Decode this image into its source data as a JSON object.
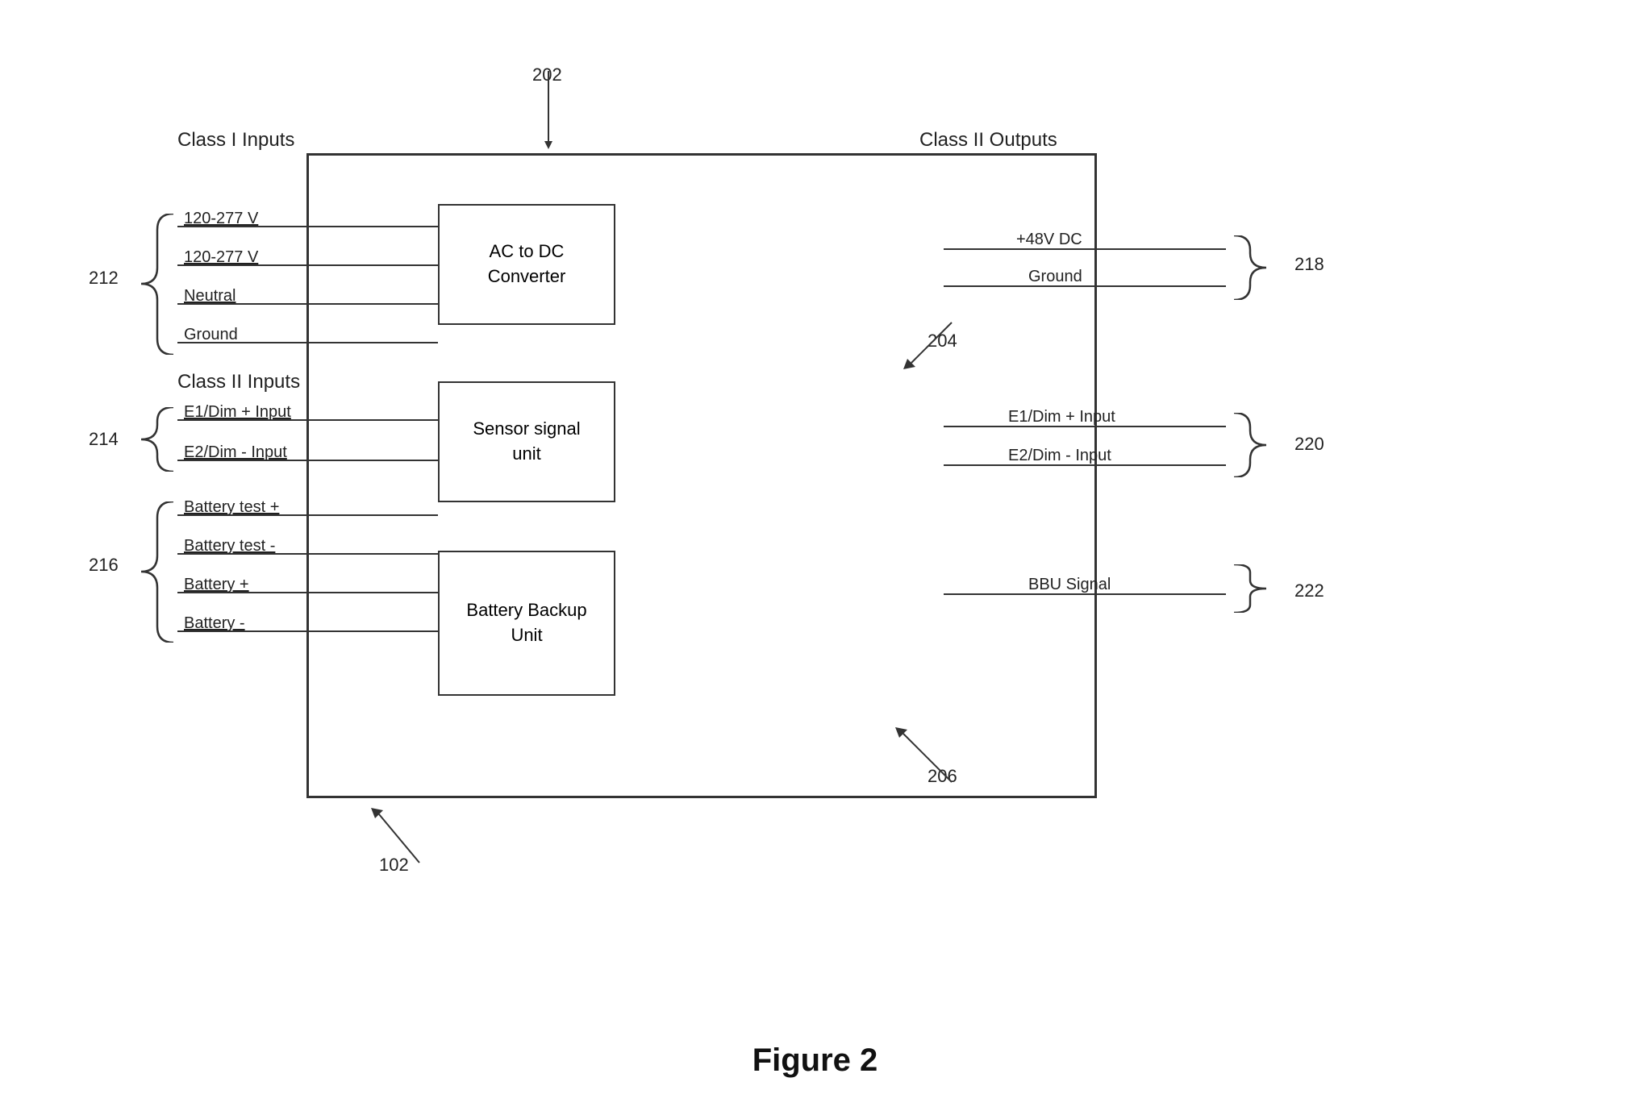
{
  "diagram": {
    "title": "Figure 2",
    "ref_202": "202",
    "ref_102": "102",
    "ref_204": "204",
    "ref_206": "206",
    "ref_212": "212",
    "ref_214": "214",
    "ref_216": "216",
    "ref_218": "218",
    "ref_220": "220",
    "ref_222": "222",
    "class_i_inputs": "Class I Inputs",
    "class_ii_inputs": "Class II Inputs",
    "class_ii_outputs": "Class II Outputs",
    "ac_dc_label": "AC to DC\nConverter",
    "sensor_label": "Sensor signal\nunit",
    "bbu_label": "Battery Backup\nUnit",
    "inputs_class_i": [
      "120-277 V",
      "120-277 V",
      "Neutral",
      "Ground"
    ],
    "inputs_class_ii_214": [
      "E1/Dim + Input",
      "E2/Dim - Input"
    ],
    "inputs_class_ii_216": [
      "Battery test +",
      "Battery test -",
      "Battery +",
      "Battery -"
    ],
    "outputs_218": [
      "+48V DC",
      "Ground"
    ],
    "outputs_220": [
      "E1/Dim + Input",
      "E2/Dim - Input"
    ],
    "outputs_222": [
      "BBU Signal"
    ]
  }
}
